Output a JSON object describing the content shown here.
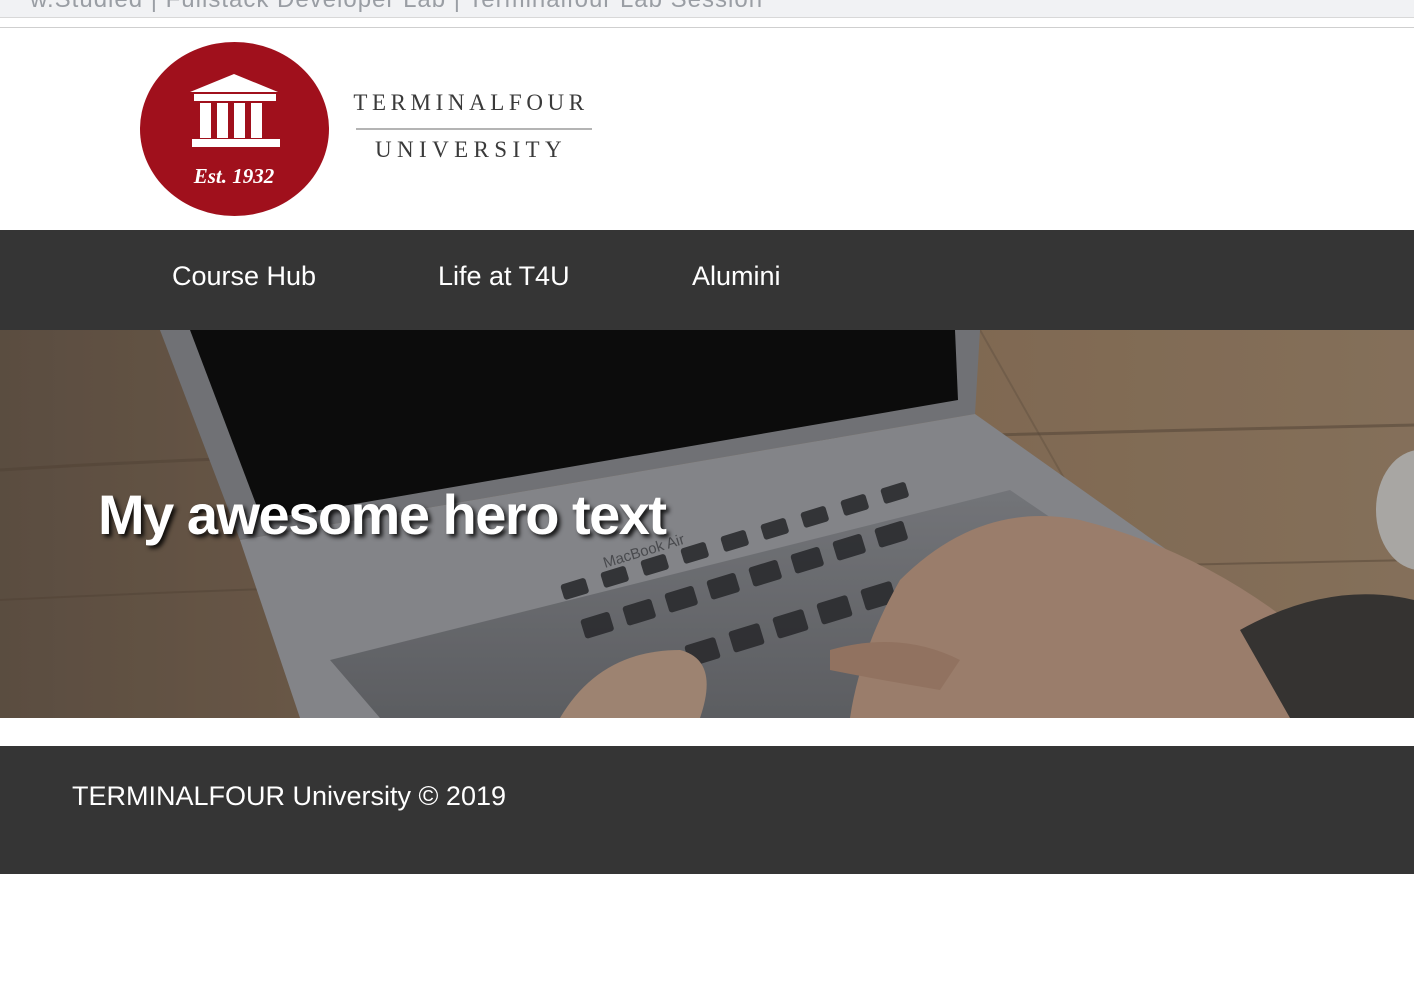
{
  "browser": {
    "partial_text": "w.Studied | Fullstack Developer Lab | Terminalfour Lab Session"
  },
  "logo": {
    "seal_text": "Est. 1932",
    "wordmark_top": "TERMINALFOUR",
    "wordmark_bottom": "UNIVERSITY",
    "brand_color": "#a0101c"
  },
  "nav": {
    "items": [
      {
        "label": "Course Hub"
      },
      {
        "label": "Life at T4U"
      },
      {
        "label": "Alumini"
      }
    ],
    "background": "#353535"
  },
  "hero": {
    "title": "My awesome hero text",
    "image_label": "MacBook Air"
  },
  "footer": {
    "text": "TERMINALFOUR University © 2019",
    "background": "#353535"
  }
}
